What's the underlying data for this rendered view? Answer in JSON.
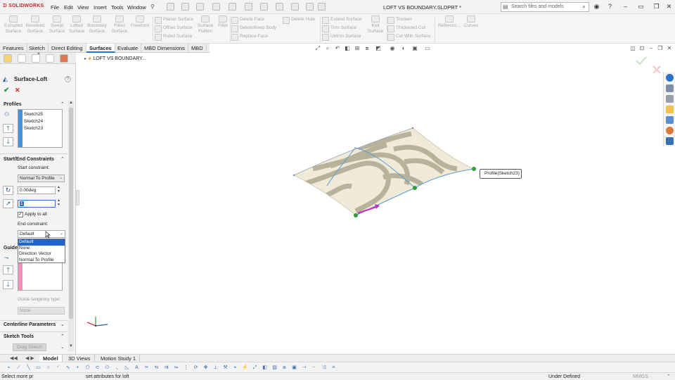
{
  "app": {
    "logo_text": "SOLIDWORKS",
    "document_title": "LOFT VS BOUNDARY.SLDPRT *"
  },
  "menu": [
    "File",
    "Edit",
    "View",
    "Insert",
    "Tools",
    "Window"
  ],
  "search": {
    "placeholder": "Search files and models"
  },
  "command_manager": {
    "big_tools": [
      "Extruded Surface",
      "Revolved Surface",
      "Swept Surface",
      "Lofted Surface",
      "Boundary Surface",
      "Filled Surface",
      "Freeform"
    ],
    "col1": [
      "Planar Surface",
      "Offset Surface",
      "Ruled Surface"
    ],
    "surface_flatten": "Surface Flatten",
    "fillet": "Fillet",
    "col2": [
      "Delete Face",
      "Delete/Keep Body",
      "Replace Face"
    ],
    "delete_hole": "Delete Hole",
    "col3": [
      "Extend Surface",
      "Trim Surface",
      "Untrim Surface"
    ],
    "knit_surface": "Knit Surface",
    "col4": [
      "Thicken",
      "Thickened Cut",
      "Cut With Surface"
    ],
    "reference": "Referenc...",
    "curves": "Curves"
  },
  "tabs": [
    "Features",
    "Sketch",
    "Direct Editing",
    "Surfaces",
    "Evaluate",
    "MBD Dimensions",
    "MBD"
  ],
  "active_tab": "Surfaces",
  "property_manager": {
    "title": "Surface-Loft",
    "profiles_title": "Profiles",
    "profiles": [
      "Sketch25",
      "Sketch24",
      "Sketch23"
    ],
    "constraints_title": "Start/End Constraints",
    "start_constraint_label": "Start constraint:",
    "start_constraint_value": "Normal To Profile",
    "angle_value": "0.00deg",
    "tangent_length_value": "1",
    "apply_to_all": "Apply to all",
    "end_constraint_label": "End constraint:",
    "end_constraint_value": "Default",
    "end_constraint_options": [
      "Default",
      "None",
      "Direction Vector",
      "Normal To Profile"
    ],
    "guide_title": "Guide",
    "guide_tangency_label": "Guide tangency type:",
    "guide_tangency_value": "None",
    "centerline_title": "Centerline Parameters",
    "sketch_tools_title": "Sketch Tools",
    "drag_sketch": "Drag Sketch"
  },
  "feature_tree_item": "LOFT VS BOUNDARY...",
  "tooltip": "Profile(Sketch23)",
  "bottom_tabs": [
    "Model",
    "3D Views",
    "Motion Study 1"
  ],
  "active_bottom_tab": "Model",
  "status": {
    "left": "Select more pr",
    "hint": "set attributes for loft",
    "state": "Under Defined",
    "units": "MMGS"
  },
  "colors": {
    "accent": "#2a73c9",
    "brand": "#d21f26",
    "surface_base": "#f0ebd8",
    "surface_band": "#b8b29a",
    "profile_edge": "#5c9bd6",
    "vertex": "#2e9a3a",
    "direction_arrow": "#c22fc4"
  }
}
